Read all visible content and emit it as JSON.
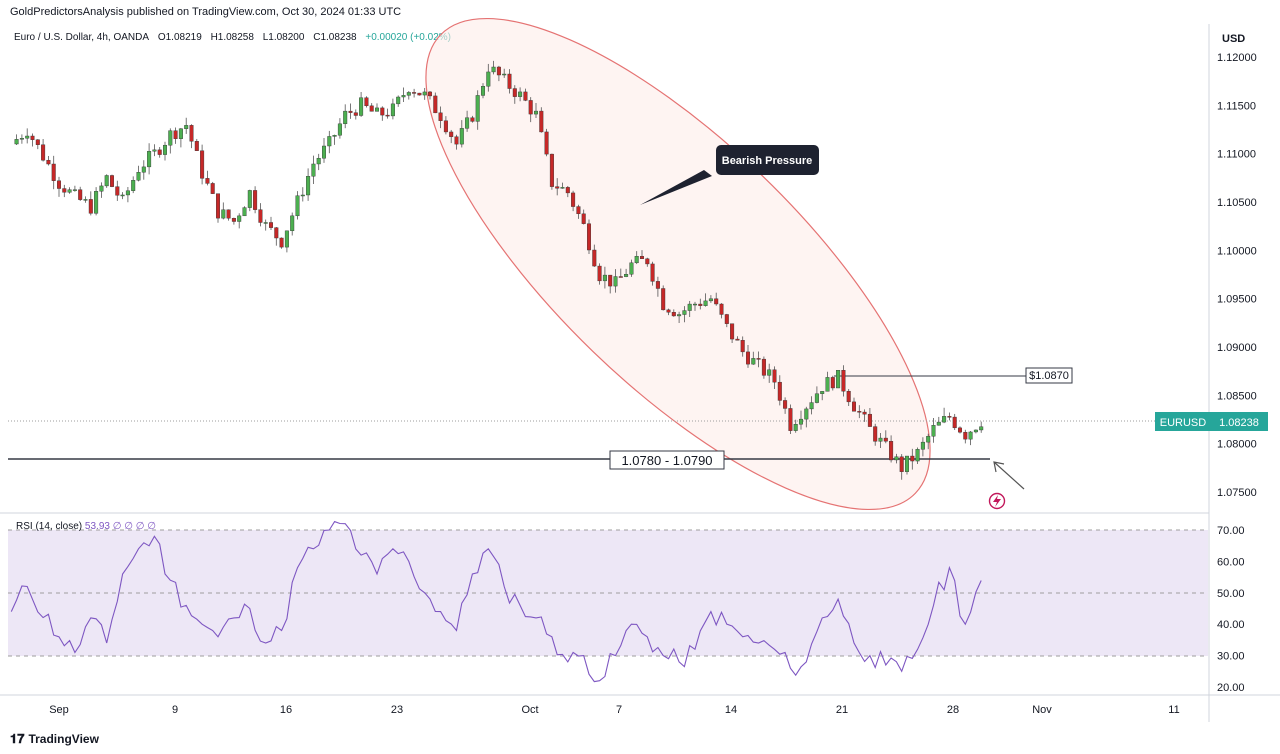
{
  "header": {
    "publisher_text": "GoldPredictorsAnalysis published on TradingView.com, Oct 30, 2024 01:33 UTC"
  },
  "legend": {
    "symbol": "Euro / U.S. Dollar, 4h, OANDA",
    "open": "O1.08219",
    "high": "H1.08258",
    "low": "L1.08200",
    "close": "C1.08238",
    "change": "+0.00020 (+0.02%)"
  },
  "price_axis": {
    "currency": "USD",
    "ticks": [
      "1.12000",
      "1.11500",
      "1.11000",
      "1.10500",
      "1.10000",
      "1.09500",
      "1.09000",
      "1.08500",
      "1.08000",
      "1.07500"
    ]
  },
  "annotations": {
    "callout": "Bearish Pressure",
    "support_label": "1.0780 - 1.0790",
    "resistance_label": "$1.0870",
    "symbol_tag": "EURUSD",
    "last_price": "1.08238"
  },
  "rsi": {
    "label": "RSI (14, close)",
    "value": "53.93",
    "extra": "∅ ∅ ∅ ∅",
    "ticks": [
      "70.00",
      "60.00",
      "50.00",
      "40.00",
      "30.00",
      "20.00"
    ]
  },
  "time_axis": {
    "ticks": [
      "Sep",
      "9",
      "16",
      "23",
      "Oct",
      "7",
      "14",
      "21",
      "28",
      "Nov",
      "11"
    ]
  },
  "footer": {
    "brand": "TradingView"
  },
  "colors": {
    "up": "#26a69a",
    "down": "#ef5350",
    "candle_up": "#4caf50",
    "candle_down": "#c62828",
    "rsi_line": "#7e57c2",
    "rsi_band": "#ede7f6",
    "ellipse": "#e57373",
    "tag_bg": "#26a69a"
  },
  "chart_data": {
    "type": "candlestick",
    "title": "Euro / U.S. Dollar, 4h, OANDA",
    "ylim": [
      1.0725,
      1.122
    ],
    "support_zone": [
      1.078,
      1.079
    ],
    "resistance": 1.087,
    "last": 1.08238,
    "path": [
      [
        "Aug 30",
        1.111
      ],
      [
        "Aug 31",
        1.1125
      ],
      [
        "Sep 2",
        1.107
      ],
      [
        "Sep 3",
        1.1055
      ],
      [
        "Sep 4",
        1.1045
      ],
      [
        "Sep 5",
        1.1075
      ],
      [
        "Sep 6",
        1.105
      ],
      [
        "Sep 7",
        1.1085
      ],
      [
        "Sep 8",
        1.11
      ],
      [
        "Sep 9",
        1.112
      ],
      [
        "Sep 10",
        1.113
      ],
      [
        "Sep 11",
        1.108
      ],
      [
        "Sep 12",
        1.104
      ],
      [
        "Sep 13",
        1.103
      ],
      [
        "Sep 14",
        1.106
      ],
      [
        "Sep 15",
        1.1025
      ],
      [
        "Sep 16",
        1.101
      ],
      [
        "Sep 17",
        1.105
      ],
      [
        "Sep 18",
        1.109
      ],
      [
        "Sep 19",
        1.111
      ],
      [
        "Sep 20",
        1.114
      ],
      [
        "Sep 21",
        1.115
      ],
      [
        "Sep 22",
        1.114
      ],
      [
        "Sep 23",
        1.1145
      ],
      [
        "Sep 24",
        1.117
      ],
      [
        "Sep 25",
        1.116
      ],
      [
        "Sep 26",
        1.114
      ],
      [
        "Sep 27",
        1.111
      ],
      [
        "Sep 28",
        1.114
      ],
      [
        "Sep 29",
        1.119
      ],
      [
        "Sep 30",
        1.1175
      ],
      [
        "Oct 1",
        1.116
      ],
      [
        "Oct 2",
        1.114
      ],
      [
        "Oct 3",
        1.107
      ],
      [
        "Oct 4",
        1.106
      ],
      [
        "Oct 5",
        1.1025
      ],
      [
        "Oct 6",
        1.0975
      ],
      [
        "Oct 7",
        1.0965
      ],
      [
        "Oct 8",
        1.0985
      ],
      [
        "Oct 9",
        1.099
      ],
      [
        "Oct 10",
        1.0945
      ],
      [
        "Oct 11",
        1.0935
      ],
      [
        "Oct 12",
        1.0945
      ],
      [
        "Oct 13",
        1.095
      ],
      [
        "Oct 14",
        1.092
      ],
      [
        "Oct 15",
        1.0895
      ],
      [
        "Oct 16",
        1.088
      ],
      [
        "Oct 17",
        1.0865
      ],
      [
        "Oct 18",
        1.082
      ],
      [
        "Oct 19",
        1.084
      ],
      [
        "Oct 20",
        1.086
      ],
      [
        "Oct 21",
        1.0868
      ],
      [
        "Oct 22",
        1.084
      ],
      [
        "Oct 23",
        1.0815
      ],
      [
        "Oct 24",
        1.0795
      ],
      [
        "Oct 25",
        1.0775
      ],
      [
        "Oct 26",
        1.079
      ],
      [
        "Oct 27",
        1.0815
      ],
      [
        "Oct 28",
        1.0828
      ],
      [
        "Oct 29",
        1.081
      ],
      [
        "Oct 30",
        1.0824
      ]
    ],
    "rsi": {
      "ylim": [
        20,
        75
      ],
      "overbought": 70,
      "middle": 50,
      "oversold": 30,
      "last": 53.93,
      "path": [
        [
          "Aug 30",
          44
        ],
        [
          "Aug 31",
          52
        ],
        [
          "Sep 2",
          36
        ],
        [
          "Sep 3",
          31
        ],
        [
          "Sep 4",
          42
        ],
        [
          "Sep 5",
          34
        ],
        [
          "Sep 6",
          56
        ],
        [
          "Sep 7",
          64
        ],
        [
          "Sep 8",
          68
        ],
        [
          "Sep 9",
          54
        ],
        [
          "Sep 10",
          46
        ],
        [
          "Sep 11",
          40
        ],
        [
          "Sep 12",
          36
        ],
        [
          "Sep 13",
          42
        ],
        [
          "Sep 14",
          45
        ],
        [
          "Sep 15",
          34
        ],
        [
          "Sep 16",
          38
        ],
        [
          "Sep 17",
          58
        ],
        [
          "Sep 18",
          64
        ],
        [
          "Sep 19",
          70
        ],
        [
          "Sep 20",
          72
        ],
        [
          "Sep 21",
          62
        ],
        [
          "Sep 22",
          56
        ],
        [
          "Sep 23",
          64
        ],
        [
          "Sep 24",
          60
        ],
        [
          "Sep 25",
          50
        ],
        [
          "Sep 26",
          44
        ],
        [
          "Sep 27",
          38
        ],
        [
          "Sep 28",
          56
        ],
        [
          "Sep 29",
          64
        ],
        [
          "Sep 30",
          52
        ],
        [
          "Oct 1",
          46
        ],
        [
          "Oct 2",
          42
        ],
        [
          "Oct 3",
          36
        ],
        [
          "Oct 4",
          28
        ],
        [
          "Oct 5",
          30
        ],
        [
          "Oct 6",
          22
        ],
        [
          "Oct 7",
          30
        ],
        [
          "Oct 8",
          40
        ],
        [
          "Oct 9",
          36
        ],
        [
          "Oct 10",
          30
        ],
        [
          "Oct 11",
          28
        ],
        [
          "Oct 12",
          32
        ],
        [
          "Oct 13",
          44
        ],
        [
          "Oct 14",
          40
        ],
        [
          "Oct 15",
          36
        ],
        [
          "Oct 16",
          34
        ],
        [
          "Oct 17",
          32
        ],
        [
          "Oct 18",
          26
        ],
        [
          "Oct 19",
          28
        ],
        [
          "Oct 20",
          42
        ],
        [
          "Oct 21",
          48
        ],
        [
          "Oct 22",
          34
        ],
        [
          "Oct 23",
          30
        ],
        [
          "Oct 24",
          27
        ],
        [
          "Oct 25",
          25
        ],
        [
          "Oct 26",
          32
        ],
        [
          "Oct 27",
          46
        ],
        [
          "Oct 28",
          58
        ],
        [
          "Oct 29",
          40
        ],
        [
          "Oct 30",
          53.93
        ]
      ]
    }
  }
}
